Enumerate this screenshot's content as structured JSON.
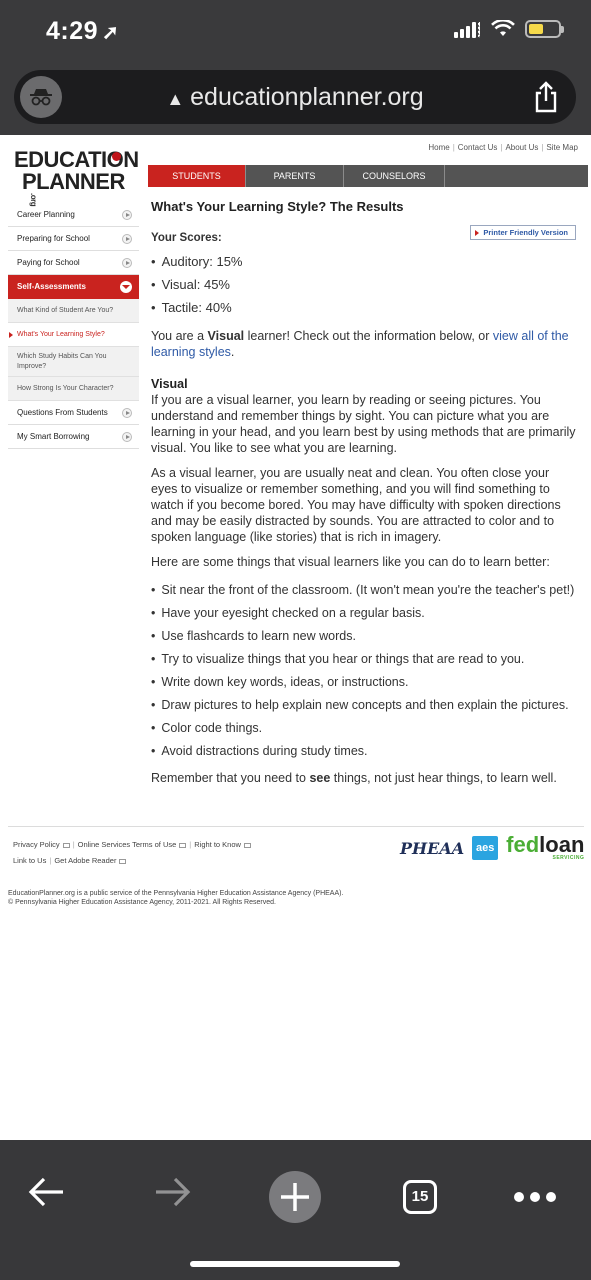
{
  "status": {
    "time": "4:29",
    "battery_color": "#f5d94a"
  },
  "browser": {
    "url": "educationplanner.org",
    "tab_count": "15"
  },
  "site": {
    "logo_line1": "EDUCATION",
    "logo_line2": "PLANNER",
    "logo_suffix": ".org",
    "top_links": [
      "Home",
      "Contact Us",
      "About Us",
      "Site Map"
    ],
    "nav_tabs": [
      "STUDENTS",
      "PARENTS",
      "COUNSELORS"
    ],
    "accent_color": "#c9231f"
  },
  "sidebar": {
    "items": [
      {
        "label": "Career Planning"
      },
      {
        "label": "Preparing for School"
      },
      {
        "label": "Paying for School"
      }
    ],
    "section": "Self-Assessments",
    "sub_items": [
      "What Kind of Student Are You?",
      "What's Your Learning Style?",
      "Which Study Habits Can You Improve?",
      "How Strong Is Your Character?"
    ],
    "items_after": [
      {
        "label": "Questions From Students"
      },
      {
        "label": "My Smart Borrowing"
      }
    ]
  },
  "main": {
    "title": "What's Your Learning Style? The Results",
    "scores_heading": "Your Scores:",
    "printer_link": "Printer Friendly Version",
    "scores": [
      "Auditory: 15%",
      "Visual: 45%",
      "Tactile: 40%"
    ],
    "result_pre": "You are a ",
    "result_bold": "Visual",
    "result_post": " learner! Check out the information below, or ",
    "result_link": "view all of the learning styles",
    "result_end": ".",
    "section_heading": "Visual",
    "para1": "If you are a visual learner, you learn by reading or seeing pictures. You understand and remember things by sight. You can picture what you are learning in your head, and you learn best by using methods that are primarily visual. You like to see what you are learning.",
    "para2": "As a visual learner, you are usually neat and clean. You often close your eyes to visualize or remember something, and you will find something to watch if you become bored. You may have difficulty with spoken directions and may be easily distracted by sounds. You are attracted to color and to spoken language (like stories) that is rich in imagery.",
    "para3": "Here are some things that visual learners like you can do to learn better:",
    "tips": [
      "Sit near the front of the classroom. (It won't mean you're the teacher's pet!)",
      "Have your eyesight checked on a regular basis.",
      "Use flashcards to learn new words.",
      "Try to visualize things that you hear or things that are read to you.",
      "Write down key words, ideas, or instructions.",
      "Draw pictures to help explain new concepts and then explain the pictures.",
      "Color code things.",
      "Avoid distractions during study times."
    ],
    "closing_pre": "Remember that you need to ",
    "closing_bold": "see",
    "closing_post": " things, not just hear things, to learn well."
  },
  "footer": {
    "links_row1": [
      "Privacy Policy",
      "Online Services Terms of Use",
      "Right to Know"
    ],
    "links_row2": [
      "Link to Us",
      "Get Adobe Reader"
    ],
    "partners": {
      "pheaa": "PHEAA",
      "aes": "aes",
      "fedloan_a": "fed",
      "fedloan_b": "loan",
      "fedloan_sub": "SERVICING"
    },
    "copyright1": "EducationPlanner.org is a public service of the Pennsylvania Higher Education Assistance Agency (PHEAA).",
    "copyright2": "© Pennsylvania Higher Education Assistance Agency, 2011-2021. All Rights Reserved."
  }
}
